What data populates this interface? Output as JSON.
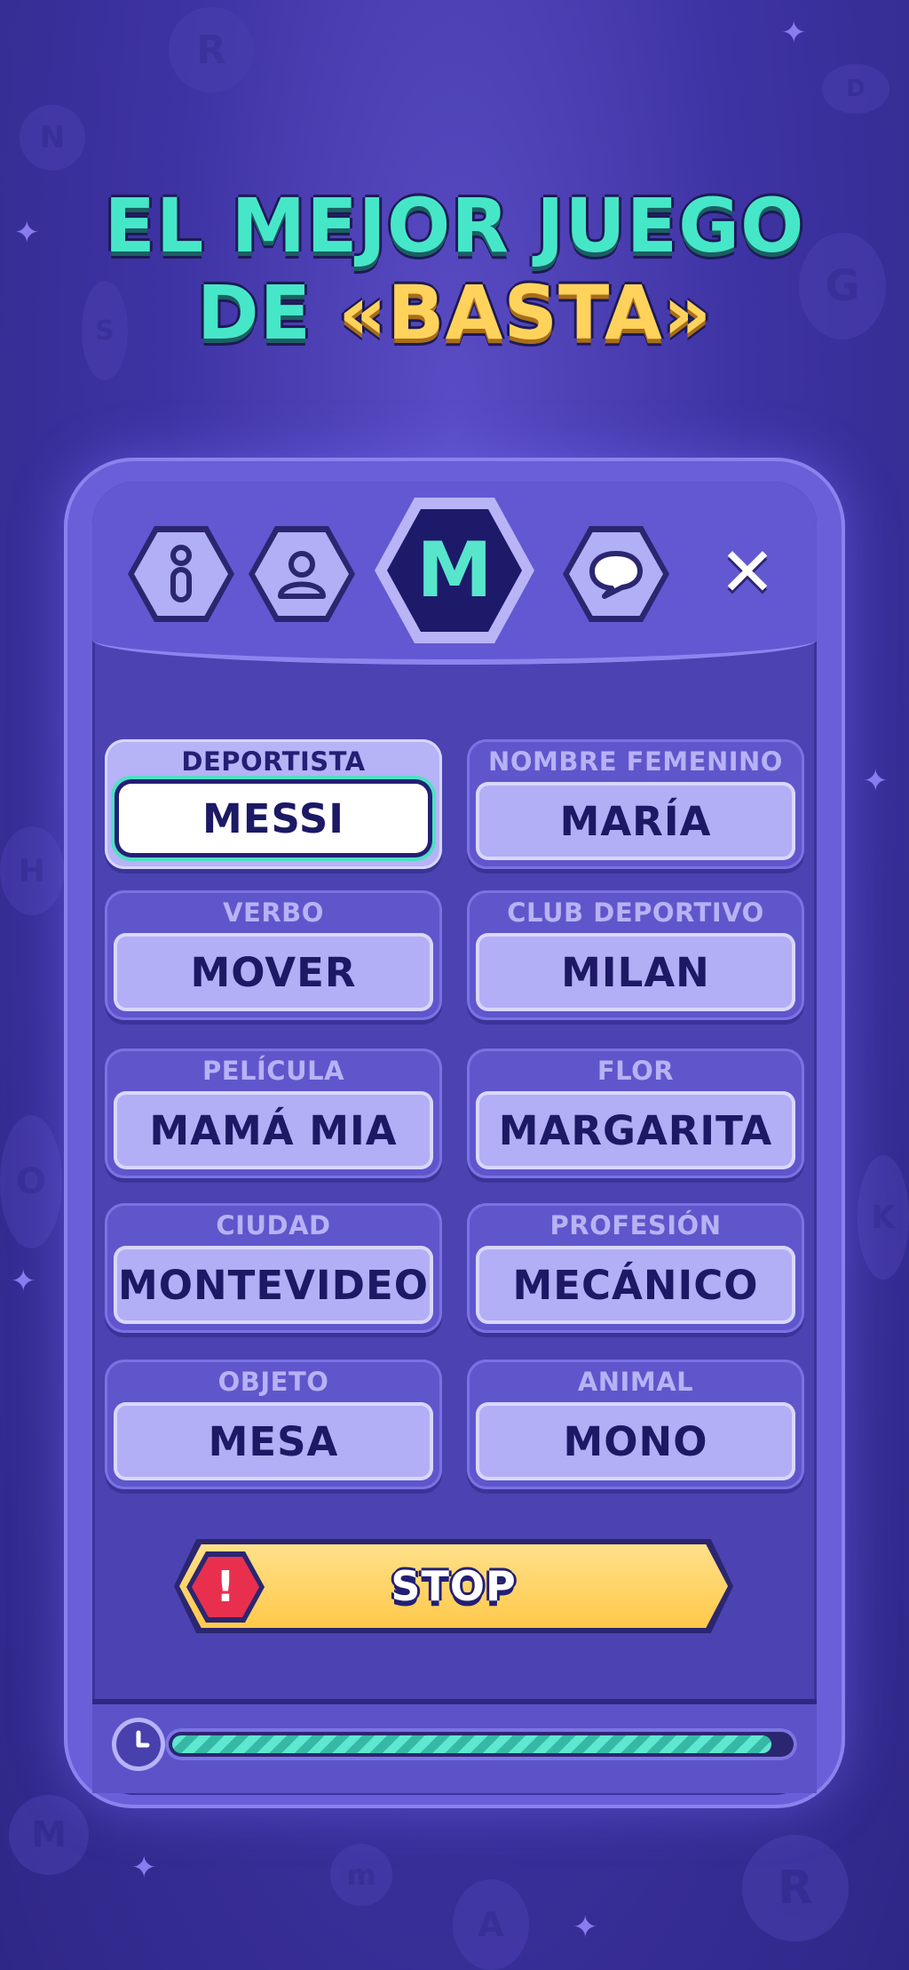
{
  "headline": {
    "line1": "EL MEJOR JUEGO",
    "line2_prefix": "DE ",
    "line2_highlight": "«BASTA»"
  },
  "header": {
    "current_letter": "M",
    "close_symbol": "✕",
    "icons": [
      "info-icon",
      "player-icon",
      "chat-icon"
    ]
  },
  "categories": [
    {
      "label": "DEPORTISTA",
      "value": "MESSI",
      "active": true
    },
    {
      "label": "NOMBRE FEMENINO",
      "value": "MARÍA"
    },
    {
      "label": "VERBO",
      "value": "MOVER"
    },
    {
      "label": "CLUB DEPORTIVO",
      "value": "MILAN"
    },
    {
      "label": "PELÍCULA",
      "value": "MAMÁ MIA"
    },
    {
      "label": "FLOR",
      "value": "MARGARITA"
    },
    {
      "label": "CIUDAD",
      "value": "MONTEVIDEO"
    },
    {
      "label": "PROFESIÓN",
      "value": "MECÁNICO"
    },
    {
      "label": "OBJETO",
      "value": "MESA"
    },
    {
      "label": "ANIMAL",
      "value": "MONO"
    }
  ],
  "stop_button": {
    "label": "STOP",
    "icon": "alert-icon",
    "icon_glyph": "!"
  },
  "timer": {
    "icon": "clock-icon",
    "progress": 0.97
  },
  "colors": {
    "accent_teal": "#46e7c8",
    "accent_gold": "#ffd35b",
    "stop_red": "#e8304e"
  }
}
